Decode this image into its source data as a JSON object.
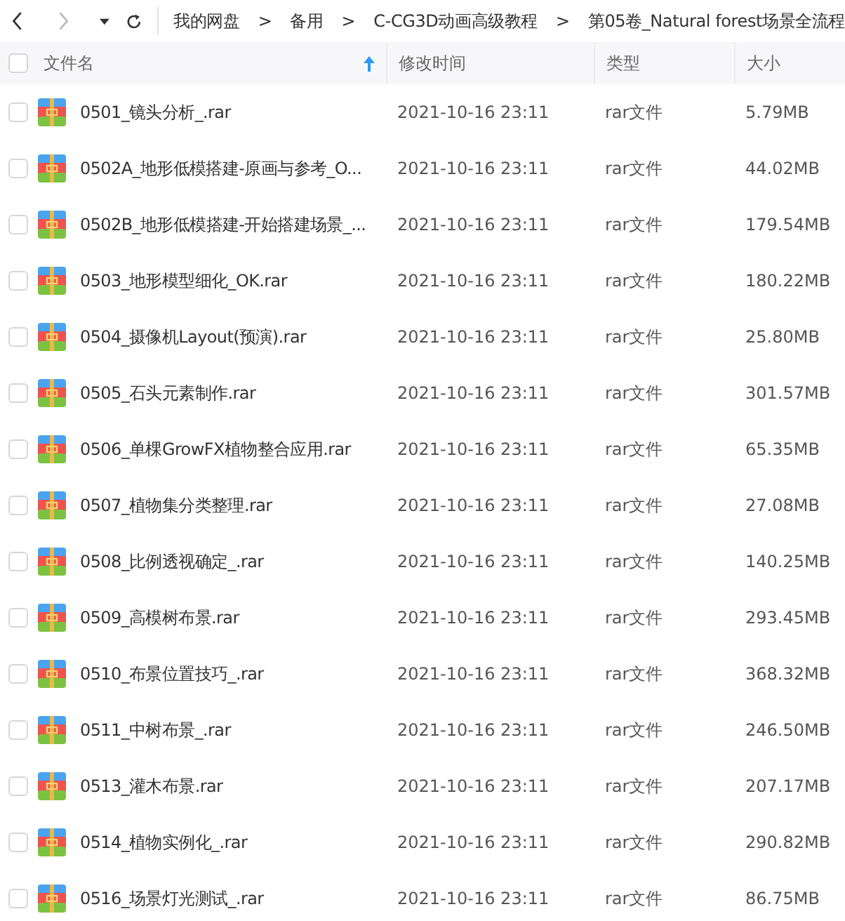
{
  "toolbar": {
    "back_disabled": false,
    "forward_disabled": true,
    "breadcrumb": [
      {
        "kind": "folder",
        "label": "我的网盘"
      },
      {
        "kind": "separator",
        "label": ">"
      },
      {
        "kind": "folder",
        "label": "备用"
      },
      {
        "kind": "separator",
        "label": ">"
      },
      {
        "kind": "folder",
        "label": "C-CG3D动画高级教程"
      },
      {
        "kind": "separator",
        "label": ">"
      },
      {
        "kind": "folder",
        "label": "第05卷_Natural forest场景全流程"
      }
    ]
  },
  "table": {
    "select_all_checked": false,
    "columns": [
      {
        "label": "文件名",
        "sorted_ascending": true
      },
      {
        "label": "修改时间",
        "sorted_ascending": false
      },
      {
        "label": "类型",
        "sorted_ascending": false
      },
      {
        "label": "大小",
        "sorted_ascending": false
      }
    ],
    "rows": [
      {
        "checked": false,
        "name": "0501_镜头分析_.rar",
        "modified": "2021-10-16 23:11",
        "type": "rar文件",
        "size": "5.79MB"
      },
      {
        "checked": false,
        "name": "0502A_地形低模搭建-原画与参考_O...",
        "modified": "2021-10-16 23:11",
        "type": "rar文件",
        "size": "44.02MB"
      },
      {
        "checked": false,
        "name": "0502B_地形低模搭建-开始搭建场景_...",
        "modified": "2021-10-16 23:11",
        "type": "rar文件",
        "size": "179.54MB"
      },
      {
        "checked": false,
        "name": "0503_地形模型细化_OK.rar",
        "modified": "2021-10-16 23:11",
        "type": "rar文件",
        "size": "180.22MB"
      },
      {
        "checked": false,
        "name": "0504_摄像机Layout(预演).rar",
        "modified": "2021-10-16 23:11",
        "type": "rar文件",
        "size": "25.80MB"
      },
      {
        "checked": false,
        "name": "0505_石头元素制作.rar",
        "modified": "2021-10-16 23:11",
        "type": "rar文件",
        "size": "301.57MB"
      },
      {
        "checked": false,
        "name": "0506_单棵GrowFX植物整合应用.rar",
        "modified": "2021-10-16 23:11",
        "type": "rar文件",
        "size": "65.35MB"
      },
      {
        "checked": false,
        "name": "0507_植物集分类整理.rar",
        "modified": "2021-10-16 23:11",
        "type": "rar文件",
        "size": "27.08MB"
      },
      {
        "checked": false,
        "name": "0508_比例透视确定_.rar",
        "modified": "2021-10-16 23:11",
        "type": "rar文件",
        "size": "140.25MB"
      },
      {
        "checked": false,
        "name": "0509_高模树布景.rar",
        "modified": "2021-10-16 23:11",
        "type": "rar文件",
        "size": "293.45MB"
      },
      {
        "checked": false,
        "name": "0510_布景位置技巧_.rar",
        "modified": "2021-10-16 23:11",
        "type": "rar文件",
        "size": "368.32MB"
      },
      {
        "checked": false,
        "name": "0511_中树布景_.rar",
        "modified": "2021-10-16 23:11",
        "type": "rar文件",
        "size": "246.50MB"
      },
      {
        "checked": false,
        "name": "0513_灌木布景.rar",
        "modified": "2021-10-16 23:11",
        "type": "rar文件",
        "size": "207.17MB"
      },
      {
        "checked": false,
        "name": "0514_植物实例化_.rar",
        "modified": "2021-10-16 23:11",
        "type": "rar文件",
        "size": "290.82MB"
      },
      {
        "checked": false,
        "name": "0516_场景灯光测试_.rar",
        "modified": "2021-10-16 23:11",
        "type": "rar文件",
        "size": "86.75MB"
      }
    ]
  }
}
